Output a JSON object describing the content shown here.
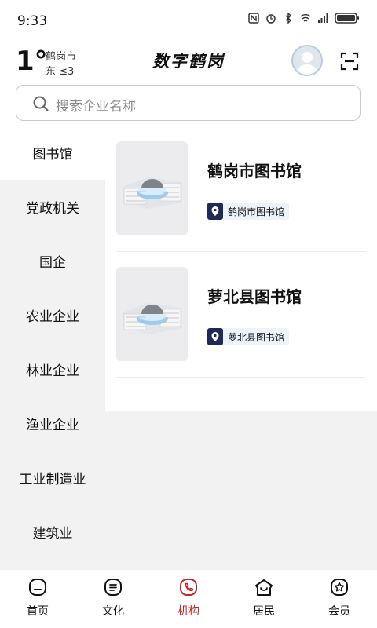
{
  "status_bar": {
    "time": "9:33",
    "icons": [
      "nfc-icon",
      "alarm-icon",
      "bluetooth-icon",
      "wifi-icon",
      "signal-icon",
      "battery-icon"
    ]
  },
  "header": {
    "temperature": "1°",
    "city": "鹤岗市",
    "wind": "东  ≤3",
    "title": "数字鹤岗"
  },
  "search": {
    "placeholder": "搜索企业名称"
  },
  "sidebar": {
    "items": [
      {
        "label": "图书馆",
        "active": true
      },
      {
        "label": "党政机关"
      },
      {
        "label": "国企"
      },
      {
        "label": "农业企业"
      },
      {
        "label": "林业企业"
      },
      {
        "label": "渔业企业"
      },
      {
        "label": "工业制造业"
      },
      {
        "label": "建筑业"
      }
    ]
  },
  "listings": [
    {
      "title": "鹤岗市图书馆",
      "tag": "鹤岗市图书馆",
      "icon": "location-pin-icon"
    },
    {
      "title": "萝北县图书馆",
      "tag": "萝北县图书馆",
      "icon": "location-pin-icon"
    }
  ],
  "bottom_nav": [
    {
      "label": "首页",
      "icon": "home-icon"
    },
    {
      "label": "文化",
      "icon": "culture-icon"
    },
    {
      "label": "机构",
      "icon": "institution-icon",
      "active": true
    },
    {
      "label": "居民",
      "icon": "residents-icon"
    },
    {
      "label": "会员",
      "icon": "member-icon"
    }
  ],
  "colors": {
    "accent": "#c0262d",
    "tag_icon_bg": "#1f2a57",
    "tag_bg": "#eef3fb",
    "panel_bg": "#f2f2f2"
  }
}
